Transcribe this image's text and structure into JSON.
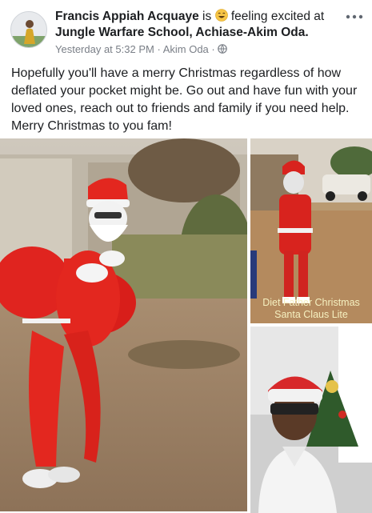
{
  "post": {
    "author": "Francis Appiah Acquaye",
    "is_text": "is",
    "feeling_text": "feeling excited at",
    "location": "Jungle Warfare School, Achiase-Akim Oda.",
    "timestamp": "Yesterday at 5:32 PM",
    "separator": "·",
    "place": "Akim Oda",
    "privacy_icon": "globe-icon",
    "more_icon": "more-options-icon",
    "body": "Hopefully you'll have a merry Christmas regardless of how deflated your pocket might be. Go out and have fun with your loved ones, reach out to friends and family if you need help. Merry Christmas to you fam!"
  },
  "photos": [
    {
      "subject": "santa-costume-carrying-sack"
    },
    {
      "subject": "thin-santa-costume",
      "caption_line1": "Diet Father Christmas",
      "caption_line2": "Santa Claus Lite"
    },
    {
      "subject": "man-with-santa-hat-selfie"
    }
  ],
  "colors": {
    "text": "#1c1e21",
    "meta": "#7a7f87",
    "santa_red": "#e0241f",
    "caption": "#f5f0c0"
  }
}
